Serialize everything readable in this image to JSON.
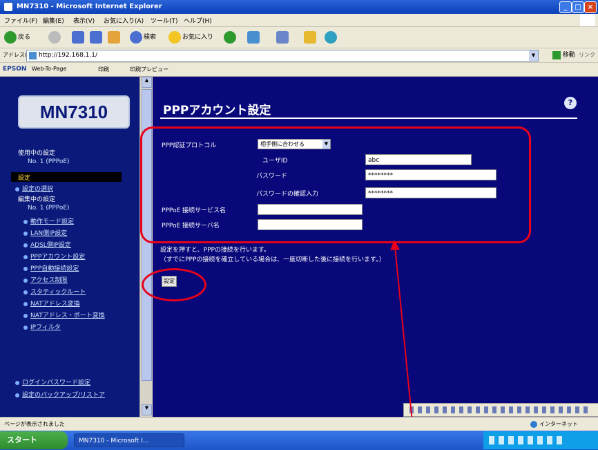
{
  "window": {
    "title": "MN7310 - Microsoft Internet Explorer",
    "controls": {
      "minimize": "_",
      "maximize": "□",
      "close": "×"
    }
  },
  "menubar": {
    "items": [
      "ファイル(F)",
      "編集(E)",
      "表示(V)",
      "お気に入り(A)",
      "ツール(T)",
      "ヘルプ(H)"
    ]
  },
  "toolbar": {
    "back_label": "戻る",
    "search_label": "検索",
    "favorites_label": "お気に入り"
  },
  "address": {
    "label": "アドレス(D)",
    "url": "http://192.168.1.1/",
    "go_label": "移動",
    "links_label": "リンク"
  },
  "linksbar": {
    "brand": "EPSON",
    "webtopage": "Web-To-Page",
    "print": "印刷",
    "preview": "印刷プレビュー"
  },
  "sidebar": {
    "logo": "MN7310",
    "using_header": "使用中の設定",
    "using_item": "No. 1 (PPPoE)",
    "selected": "設定",
    "choose_settings": "設定の選択",
    "editing_header": "編集中の設定",
    "editing_item": "No. 1 (PPPoE)",
    "links": [
      "動作モード設定",
      "LAN側IP設定",
      "ADSL側IP設定",
      "PPPアカウント設定",
      "PPP自動接続設定",
      "アクセス制限",
      "スタティックルート",
      "NATアドレス変換",
      "NATアドレス・ポート変換",
      "IPフィルタ"
    ],
    "bottom_links": [
      "ログインパスワード設定",
      "設定のバックアップ/リストア"
    ]
  },
  "main": {
    "page_title": "PPPアカウント設定",
    "help_icon": "?",
    "form": {
      "auth_protocol_label": "PPP認証プロトコル",
      "auth_protocol_value": "相手側に合わせる",
      "userid_label": "ユーザID",
      "userid_value": "abc",
      "password_label": "パスワード",
      "password_value": "********",
      "password_confirm_label": "パスワードの確認入力",
      "password_confirm_value": "********",
      "service_name_label": "PPPoE 接続サービス名",
      "service_name_value": "",
      "server_name_label": "PPPoE 接続サーバ名",
      "server_name_value": ""
    },
    "note_line1": "設定を押すと、PPPの接続を行います。",
    "note_line2": "（すでにPPPの接続を確立している場合は、一度切断した後に接続を行います。）",
    "apply_button": "設定"
  },
  "statusbar": {
    "text": "ページが表示されました",
    "zone": "インターネット"
  },
  "taskbar": {
    "start": "スタート",
    "task": "MN7310 - Microsoft I..."
  },
  "colors": {
    "sidebar_bg": "#0b1a7a",
    "main_bg": "#08087a",
    "annotation_red": "#e8001a"
  }
}
